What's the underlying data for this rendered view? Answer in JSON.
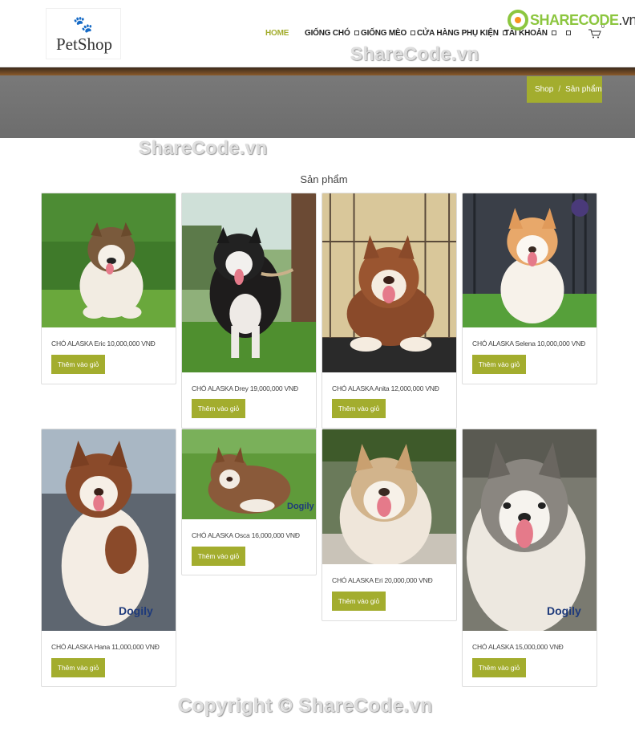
{
  "brand": {
    "logo_text": "PetShop",
    "logo_icon": "paw-icon"
  },
  "nav": {
    "items": [
      {
        "label": "HOME",
        "active": true
      },
      {
        "label": "GIỐNG CHÓ",
        "has_dropdown": true
      },
      {
        "label": "GIỐNG MÈO",
        "has_dropdown": true
      },
      {
        "label": "CỬA HÀNG PHỤ KIỆN",
        "has_dropdown": true
      },
      {
        "label": "TÀI KHOẢN",
        "has_dropdown": true
      }
    ],
    "extra_icon": "box-icon",
    "cart_icon": "cart-icon",
    "cart_count": "0"
  },
  "watermarks": {
    "logo_main": "SHARECODE",
    "logo_suffix": ".vn",
    "text1": "ShareCode.vn",
    "text2": "ShareCode.vn",
    "footer": "Copyright © ShareCode.vn"
  },
  "breadcrumb": {
    "home": "Shop",
    "separator": "/",
    "current": "Sản phẩm"
  },
  "section_title": "Sản phẩm",
  "button_label": "Thêm vào giỏ",
  "products": [
    {
      "name": "CHÓ ALASKA Eric 10,000,000 VNĐ"
    },
    {
      "name": "CHÓ ALASKA Drey 19,000,000 VNĐ"
    },
    {
      "name": "CHÓ ALASKA Anita 12,000,000 VNĐ"
    },
    {
      "name": "CHÓ ALASKA Selena 10,000,000 VNĐ"
    },
    {
      "name": "CHÓ ALASKA Hana 11,000,000 VNĐ"
    },
    {
      "name": "CHÓ ALASKA Osca 16,000,000 VNĐ"
    },
    {
      "name": "CHÓ ALASKA Eri 20,000,000 VNĐ"
    },
    {
      "name": "CHÓ ALASKA 15,000,000 VNĐ"
    }
  ],
  "photo_badge": "Dogily",
  "colors": {
    "accent": "#a3ad2e",
    "banner": "#737373",
    "text": "#444444"
  }
}
